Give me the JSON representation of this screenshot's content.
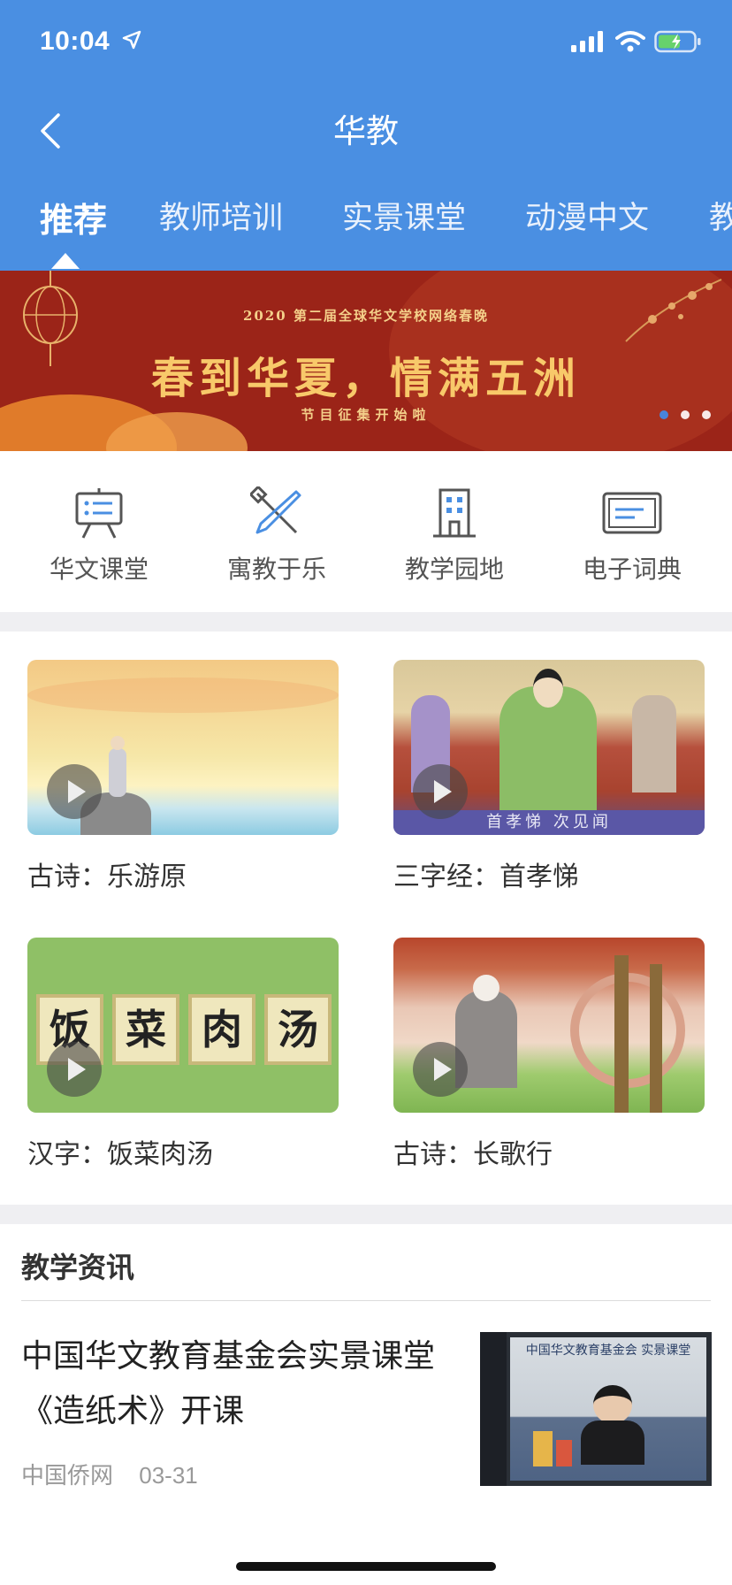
{
  "status": {
    "time": "10:04"
  },
  "header": {
    "title": "华教",
    "back_icon": "chevron-left-icon"
  },
  "tabs": [
    {
      "label": "推荐",
      "active": true
    },
    {
      "label": "教师培训",
      "active": false
    },
    {
      "label": "实景课堂",
      "active": false
    },
    {
      "label": "动漫中文",
      "active": false
    },
    {
      "label": "教",
      "active": false
    }
  ],
  "banner": {
    "small_line": "2020 第二届全球华文学校网络春晚",
    "headline": "春到华夏，情满五洲",
    "subline": "节目征集开始啦",
    "dots": 3,
    "active_dot": 0
  },
  "quick_links": [
    {
      "label": "华文课堂",
      "icon": "classroom-board-icon"
    },
    {
      "label": "寓教于乐",
      "icon": "pencil-ruler-icon"
    },
    {
      "label": "教学园地",
      "icon": "building-icon"
    },
    {
      "label": "电子词典",
      "icon": "dictionary-icon"
    }
  ],
  "videos": [
    {
      "title": "古诗：乐游原"
    },
    {
      "title": "三字经：首孝悌",
      "caption": "首孝悌  次见闻"
    },
    {
      "title": "汉字：饭菜肉汤",
      "chars": [
        "饭",
        "菜",
        "肉",
        "汤"
      ]
    },
    {
      "title": "古诗：长歌行"
    }
  ],
  "news": {
    "section_title": "教学资讯",
    "items": [
      {
        "title": "中国华文教育基金会实景课堂《造纸术》开课",
        "source": "中国侨网",
        "date": "03-31",
        "image_text": "中国华文教育基金会 实景课堂"
      }
    ]
  },
  "colors": {
    "header": "#4a8fe2",
    "banner": "#9b2418",
    "separator": "#efeff2"
  }
}
